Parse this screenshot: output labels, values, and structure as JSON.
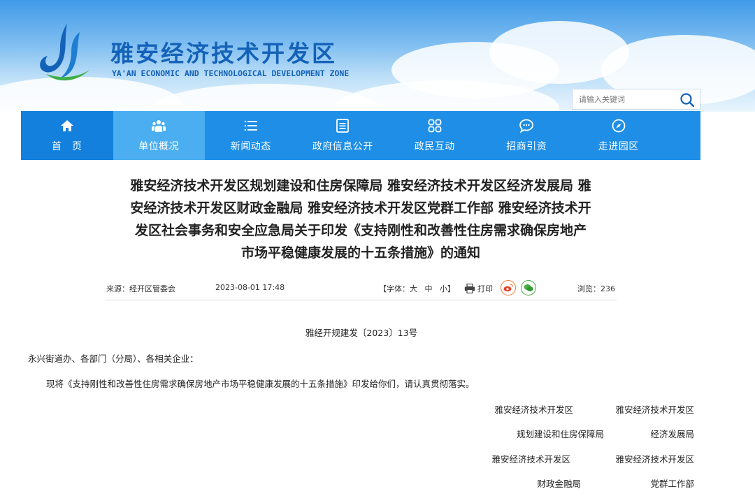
{
  "header": {
    "site_title": "雅安经济技术开发区",
    "site_subtitle": "YA'AN ECONOMIC AND TECHNOLOGICAL DEVELOPMENT ZONE",
    "logo_icon": "ya-an-logo-icon",
    "search": {
      "placeholder": "请输入关键词",
      "icon": "search-icon"
    }
  },
  "nav": {
    "items": [
      {
        "label": "首　页",
        "icon": "home-icon"
      },
      {
        "label": "单位概况",
        "icon": "people-icon",
        "active": true
      },
      {
        "label": "新闻动态",
        "icon": "list-icon"
      },
      {
        "label": "政府信息公开",
        "icon": "document-icon"
      },
      {
        "label": "政民互动",
        "icon": "grid-icon"
      },
      {
        "label": "招商引资",
        "icon": "chat-icon"
      },
      {
        "label": "走进园区",
        "icon": "compass-icon"
      }
    ]
  },
  "article": {
    "title_lines": [
      "雅安经济技术开发区规划建设和住房保障局 雅安经济技术开发区经济发展局 雅",
      "安经济技术开发区财政金融局 雅安经济技术开发区党群工作部 雅安经济技术开",
      "发区社会事务和安全应急局关于印发《支持刚性和改善性住房需求确保房地产",
      "市场平稳健康发展的十五条措施》的通知"
    ],
    "meta": {
      "source": "来源：经开区管委会",
      "datetime": "2023-08-01 17:48",
      "font_label_open": "【字体：",
      "font_large": "大",
      "font_medium": "中",
      "font_small": "小",
      "font_label_close": "】",
      "print_label": "打印",
      "views": "浏览：236"
    },
    "doc_number": "雅经开规建发〔2023〕13号",
    "addressee": "永兴街道办、各部门（分局）、各相关企业：",
    "body": "现将《支持刚性和改善性住房需求确保房地产市场平稳健康发展的十五条措施》印发给你们，请认真贯彻落实。",
    "signatures": {
      "r1_left": "雅安经济技术开发区",
      "r1_right": "雅安经济技术开发区",
      "r2_left": "规划建设和住房保障局",
      "r2_right": "经济发展局",
      "r3_left": "雅安经济技术开发区",
      "r3_right": "雅安经济技术开发区",
      "r4_left": "财政金融局",
      "r4_right": "党群工作部"
    }
  },
  "colors": {
    "nav_bg": "#1e8ee6",
    "nav_active": "#4aaef0",
    "title_blue": "#1462b8"
  }
}
